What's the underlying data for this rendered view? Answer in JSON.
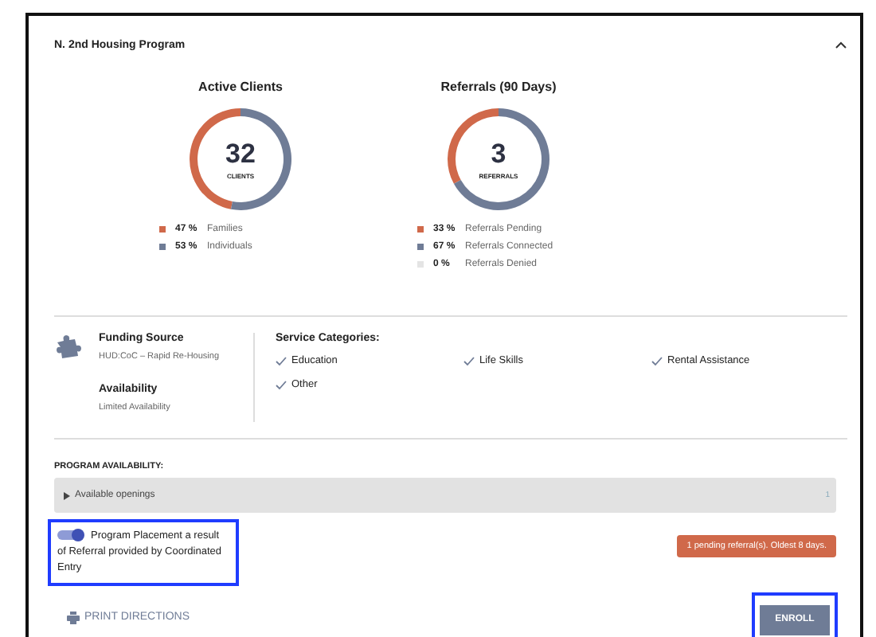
{
  "program": {
    "title": "N. 2nd Housing Program",
    "expanded": true
  },
  "charts": [
    {
      "chart_data": {
        "type": "donut",
        "title": "Active Clients",
        "categories": [
          "Families",
          "Individuals"
        ],
        "values": [
          47,
          53
        ]
      },
      "total": "32",
      "unit": "CLIENTS",
      "legend": [
        {
          "percent": "47 %",
          "color": "#d0694a"
        },
        {
          "percent": "53 %",
          "color": "#6f7c96"
        }
      ]
    },
    {
      "chart_data": {
        "type": "donut",
        "title": "Referrals (90 Days)",
        "categories": [
          "Referrals Pending",
          "Referrals Connected",
          "Referrals Denied"
        ],
        "values": [
          33,
          67,
          0
        ]
      },
      "total": "3",
      "unit": "REFERRALS",
      "legend": [
        {
          "percent": "33 %",
          "color": "#d0694a"
        },
        {
          "percent": "67 %",
          "color": "#6f7c96"
        },
        {
          "percent": "0 %",
          "color": "#e4e4e4"
        }
      ]
    }
  ],
  "funding": {
    "label": "Funding Source",
    "value": "HUD:CoC – Rapid Re-Housing"
  },
  "availability": {
    "label": "Availability",
    "value": "Limited Availability"
  },
  "services": {
    "label": "Service Categories:",
    "items": [
      {
        "label": "Education",
        "checked": true
      },
      {
        "label": "Life Skills",
        "checked": true
      },
      {
        "label": "Rental Assistance",
        "checked": true
      },
      {
        "label": "Other",
        "checked": true
      }
    ]
  },
  "program_availability": {
    "label": "PROGRAM AVAILABILITY:",
    "openings_label": "Available openings",
    "openings_count": "1",
    "expanded": false
  },
  "placement_toggle": {
    "label": "Program Placement a result of Referral provided by Coordinated Entry",
    "on": true
  },
  "pending_badge": "1 pending referral(s). Oldest 8 days.",
  "print_link": "PRINT DIRECTIONS",
  "enroll_button": "ENROLL"
}
